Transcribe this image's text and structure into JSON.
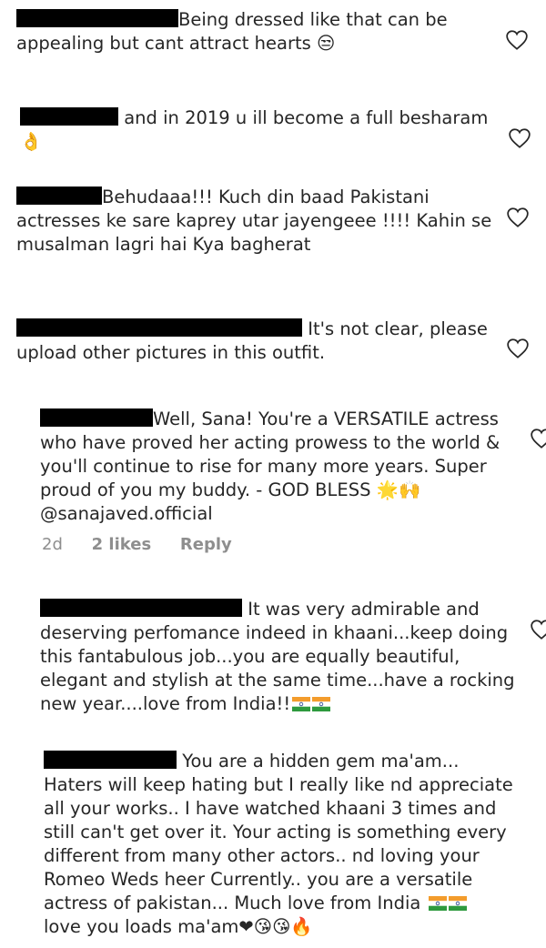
{
  "comments": [
    {
      "lines": [
        "Being  dressed like that  can be",
        "appealing but cant attract hearts"
      ],
      "emoji": "😒"
    },
    {
      "lines": [
        "and in 2019 u ill become a full besharam"
      ],
      "emoji": "👌"
    },
    {
      "lines": [
        "Behudaaa!!! Kuch din baad Pakistani",
        "actresses ke sare kaprey utar jayengeee !!!! Kahin se",
        "musalman lagri hai Kya bagherat"
      ]
    },
    {
      "lines": [
        "It's not clear, please",
        "upload other pictures in this outfit."
      ]
    },
    {
      "lines": [
        "Well, Sana! You're a VERSATILE actress",
        "who have proved her acting prowess to the world &",
        "you'll continue to rise for many more years. Super",
        "proud of you my buddy. - GOD BLESS",
        "@sanajaved.official"
      ],
      "bless_emoji": "🌟🙌",
      "meta": {
        "time": "2d",
        "likes": "2 likes",
        "reply": "Reply"
      }
    },
    {
      "lines": [
        "It was very admirable and",
        "deserving perfomance indeed in khaani...keep doing",
        "this fantabulous job...you are equally beautiful,",
        "elegant and stylish at the same time...have a rocking",
        "new year....love from India!!"
      ]
    },
    {
      "lines": [
        "You are a hidden gem ma'am...",
        "Haters will keep hating but I really like nd appreciate",
        "all your works.. I have watched khaani 3 times and",
        "still can't get over it. Your acting is something every",
        "different from many other actors.. nd loving your",
        "Romeo Weds heer Currently.. you are a versatile",
        "actress of pakistan... Much love from India",
        "love you loads ma'am"
      ],
      "end_emoji": "❤😘😘🔥"
    }
  ],
  "colors": {
    "text": "#262626",
    "meta": "#8e8e8e",
    "heart_stroke": "#262626"
  }
}
